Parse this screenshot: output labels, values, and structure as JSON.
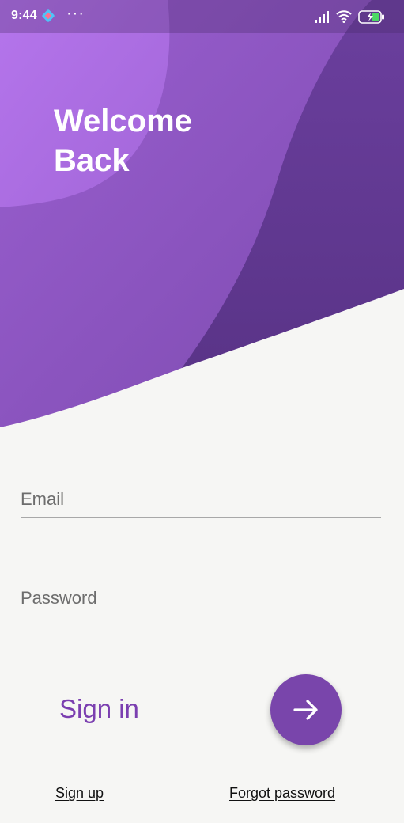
{
  "status_bar": {
    "time": "9:44",
    "app_icon": "app-icon",
    "more_indicator": "···",
    "icons": [
      "signal-icon",
      "wifi-icon",
      "battery-charging-icon"
    ]
  },
  "header": {
    "title_line1": "Welcome",
    "title_line2": "Back"
  },
  "form": {
    "email_placeholder": "Email",
    "email_value": "",
    "password_placeholder": "Password",
    "password_value": ""
  },
  "actions": {
    "sign_in_label": "Sign in",
    "submit_icon": "arrow-right-icon",
    "sign_up_label": "Sign up",
    "forgot_password_label": "Forgot password"
  },
  "colors": {
    "accent": "#7945ab",
    "sign_in_text": "#7b3fb0",
    "wave_light": "#a86adf",
    "wave_mid": "#8b55bb",
    "wave_dark": "#633a93",
    "background": "#f6f6f4"
  }
}
